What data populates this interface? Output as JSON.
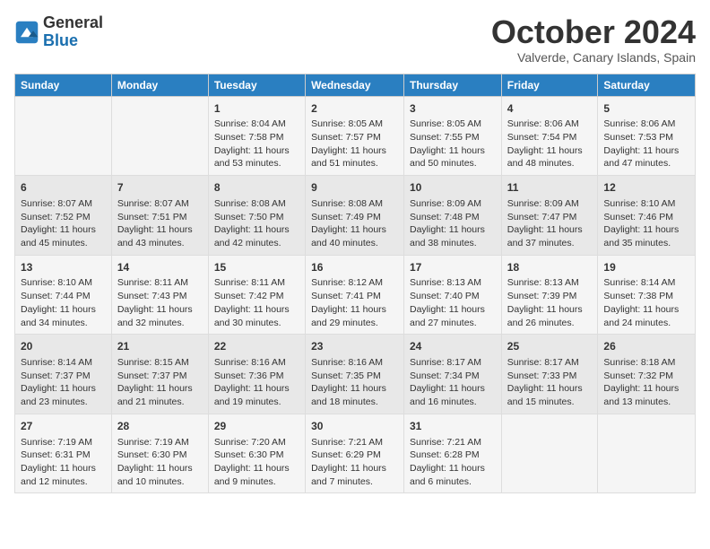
{
  "logo": {
    "general": "General",
    "blue": "Blue"
  },
  "title": "October 2024",
  "location": "Valverde, Canary Islands, Spain",
  "days_of_week": [
    "Sunday",
    "Monday",
    "Tuesday",
    "Wednesday",
    "Thursday",
    "Friday",
    "Saturday"
  ],
  "weeks": [
    [
      {
        "day": "",
        "info": ""
      },
      {
        "day": "",
        "info": ""
      },
      {
        "day": "1",
        "info": "Sunrise: 8:04 AM\nSunset: 7:58 PM\nDaylight: 11 hours and 53 minutes."
      },
      {
        "day": "2",
        "info": "Sunrise: 8:05 AM\nSunset: 7:57 PM\nDaylight: 11 hours and 51 minutes."
      },
      {
        "day": "3",
        "info": "Sunrise: 8:05 AM\nSunset: 7:55 PM\nDaylight: 11 hours and 50 minutes."
      },
      {
        "day": "4",
        "info": "Sunrise: 8:06 AM\nSunset: 7:54 PM\nDaylight: 11 hours and 48 minutes."
      },
      {
        "day": "5",
        "info": "Sunrise: 8:06 AM\nSunset: 7:53 PM\nDaylight: 11 hours and 47 minutes."
      }
    ],
    [
      {
        "day": "6",
        "info": "Sunrise: 8:07 AM\nSunset: 7:52 PM\nDaylight: 11 hours and 45 minutes."
      },
      {
        "day": "7",
        "info": "Sunrise: 8:07 AM\nSunset: 7:51 PM\nDaylight: 11 hours and 43 minutes."
      },
      {
        "day": "8",
        "info": "Sunrise: 8:08 AM\nSunset: 7:50 PM\nDaylight: 11 hours and 42 minutes."
      },
      {
        "day": "9",
        "info": "Sunrise: 8:08 AM\nSunset: 7:49 PM\nDaylight: 11 hours and 40 minutes."
      },
      {
        "day": "10",
        "info": "Sunrise: 8:09 AM\nSunset: 7:48 PM\nDaylight: 11 hours and 38 minutes."
      },
      {
        "day": "11",
        "info": "Sunrise: 8:09 AM\nSunset: 7:47 PM\nDaylight: 11 hours and 37 minutes."
      },
      {
        "day": "12",
        "info": "Sunrise: 8:10 AM\nSunset: 7:46 PM\nDaylight: 11 hours and 35 minutes."
      }
    ],
    [
      {
        "day": "13",
        "info": "Sunrise: 8:10 AM\nSunset: 7:44 PM\nDaylight: 11 hours and 34 minutes."
      },
      {
        "day": "14",
        "info": "Sunrise: 8:11 AM\nSunset: 7:43 PM\nDaylight: 11 hours and 32 minutes."
      },
      {
        "day": "15",
        "info": "Sunrise: 8:11 AM\nSunset: 7:42 PM\nDaylight: 11 hours and 30 minutes."
      },
      {
        "day": "16",
        "info": "Sunrise: 8:12 AM\nSunset: 7:41 PM\nDaylight: 11 hours and 29 minutes."
      },
      {
        "day": "17",
        "info": "Sunrise: 8:13 AM\nSunset: 7:40 PM\nDaylight: 11 hours and 27 minutes."
      },
      {
        "day": "18",
        "info": "Sunrise: 8:13 AM\nSunset: 7:39 PM\nDaylight: 11 hours and 26 minutes."
      },
      {
        "day": "19",
        "info": "Sunrise: 8:14 AM\nSunset: 7:38 PM\nDaylight: 11 hours and 24 minutes."
      }
    ],
    [
      {
        "day": "20",
        "info": "Sunrise: 8:14 AM\nSunset: 7:37 PM\nDaylight: 11 hours and 23 minutes."
      },
      {
        "day": "21",
        "info": "Sunrise: 8:15 AM\nSunset: 7:37 PM\nDaylight: 11 hours and 21 minutes."
      },
      {
        "day": "22",
        "info": "Sunrise: 8:16 AM\nSunset: 7:36 PM\nDaylight: 11 hours and 19 minutes."
      },
      {
        "day": "23",
        "info": "Sunrise: 8:16 AM\nSunset: 7:35 PM\nDaylight: 11 hours and 18 minutes."
      },
      {
        "day": "24",
        "info": "Sunrise: 8:17 AM\nSunset: 7:34 PM\nDaylight: 11 hours and 16 minutes."
      },
      {
        "day": "25",
        "info": "Sunrise: 8:17 AM\nSunset: 7:33 PM\nDaylight: 11 hours and 15 minutes."
      },
      {
        "day": "26",
        "info": "Sunrise: 8:18 AM\nSunset: 7:32 PM\nDaylight: 11 hours and 13 minutes."
      }
    ],
    [
      {
        "day": "27",
        "info": "Sunrise: 7:19 AM\nSunset: 6:31 PM\nDaylight: 11 hours and 12 minutes."
      },
      {
        "day": "28",
        "info": "Sunrise: 7:19 AM\nSunset: 6:30 PM\nDaylight: 11 hours and 10 minutes."
      },
      {
        "day": "29",
        "info": "Sunrise: 7:20 AM\nSunset: 6:30 PM\nDaylight: 11 hours and 9 minutes."
      },
      {
        "day": "30",
        "info": "Sunrise: 7:21 AM\nSunset: 6:29 PM\nDaylight: 11 hours and 7 minutes."
      },
      {
        "day": "31",
        "info": "Sunrise: 7:21 AM\nSunset: 6:28 PM\nDaylight: 11 hours and 6 minutes."
      },
      {
        "day": "",
        "info": ""
      },
      {
        "day": "",
        "info": ""
      }
    ]
  ]
}
